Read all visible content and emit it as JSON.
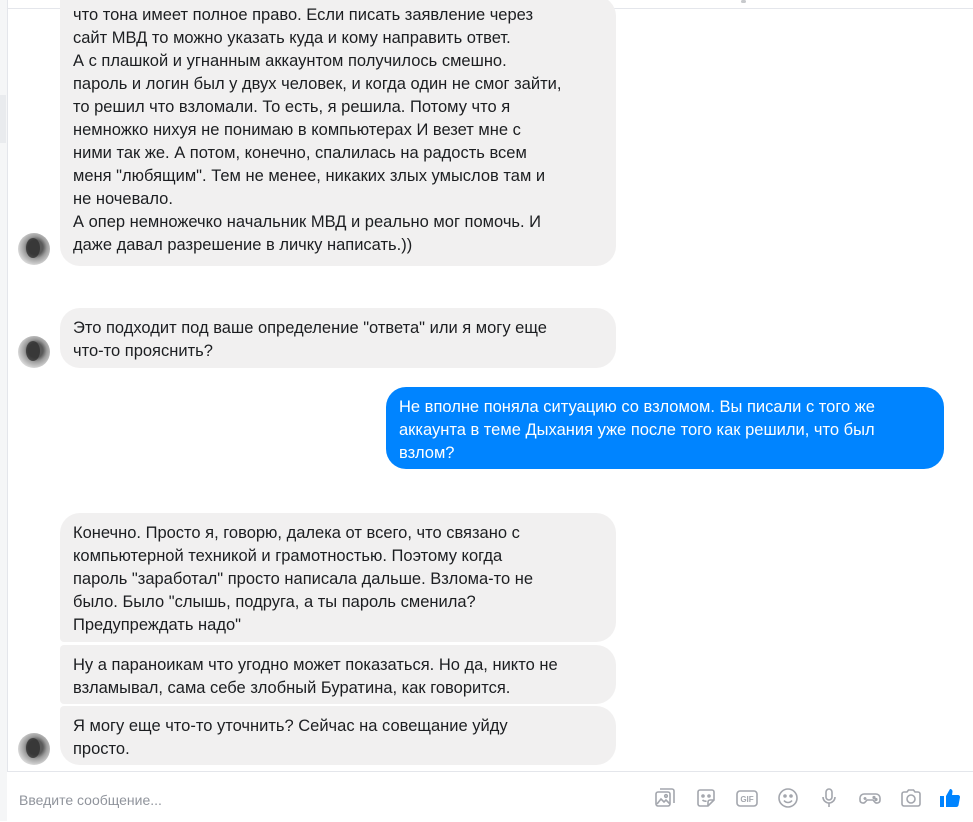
{
  "messages": [
    {
      "sender": "other",
      "text": "что тона имеет полное право. Если писать заявление через\nсайт МВД то можно указать куда и кому направить ответ.\nА с плашкой и угнанным аккаунтом получилось смешно.\nпароль и логин был у двух человек, и когда один не смог зайти,\nто решил что взломали. То есть, я решила. Потому что я\nнемножко нихуя не понимаю в компьютерах И везет мне с\nними так же. А потом, конечно, спалилась на радость всем\nменя \"любящим\". Тем не менее, никаких злых умыслов там и\nне ночевало.\nА опер немножечко начальник МВД и реально мог помочь. И\nдаже давал разрешение в личку написать.))"
    },
    {
      "sender": "other",
      "text": "Это подходит под ваше определение \"ответа\" или я могу еще\nчто-то прояснить?"
    },
    {
      "sender": "me",
      "text": "Не вполне поняла ситуацию со взломом. Вы писали с того же\nаккаунта в теме Дыхания уже после того как решили, что был\nвзлом?"
    },
    {
      "sender": "other",
      "text": "Конечно. Просто я, говорю, далека от всего, что связано с\nкомпьютерной техникой и грамотностью. Поэтому когда\nпароль \"заработал\" просто написала дальше. Взлома-то не\nбыло. Было \"слышь, подруга, а ты пароль сменила?\nПредупреждать надо\""
    },
    {
      "sender": "other",
      "text": "Ну а параноикам что угодно может показаться. Но да, никто не\nвзламывал, сама себе злобный Буратина, как говорится."
    },
    {
      "sender": "other",
      "text": "Я могу еще что-то уточнить? Сейчас на совещание уйду\nпросто."
    }
  ],
  "composer": {
    "placeholder": "Введите сообщение..."
  },
  "toolbar_icons": [
    "image-icon",
    "sticker-icon",
    "gif-icon",
    "emoji-icon",
    "microphone-icon",
    "game-controller-icon",
    "camera-icon",
    "like-icon"
  ],
  "colors": {
    "outgoing_bubble": "#0084ff",
    "incoming_bubble": "#f1f0f0",
    "toolbar_icon": "#a3a6ad",
    "like_icon": "#0084ff"
  }
}
